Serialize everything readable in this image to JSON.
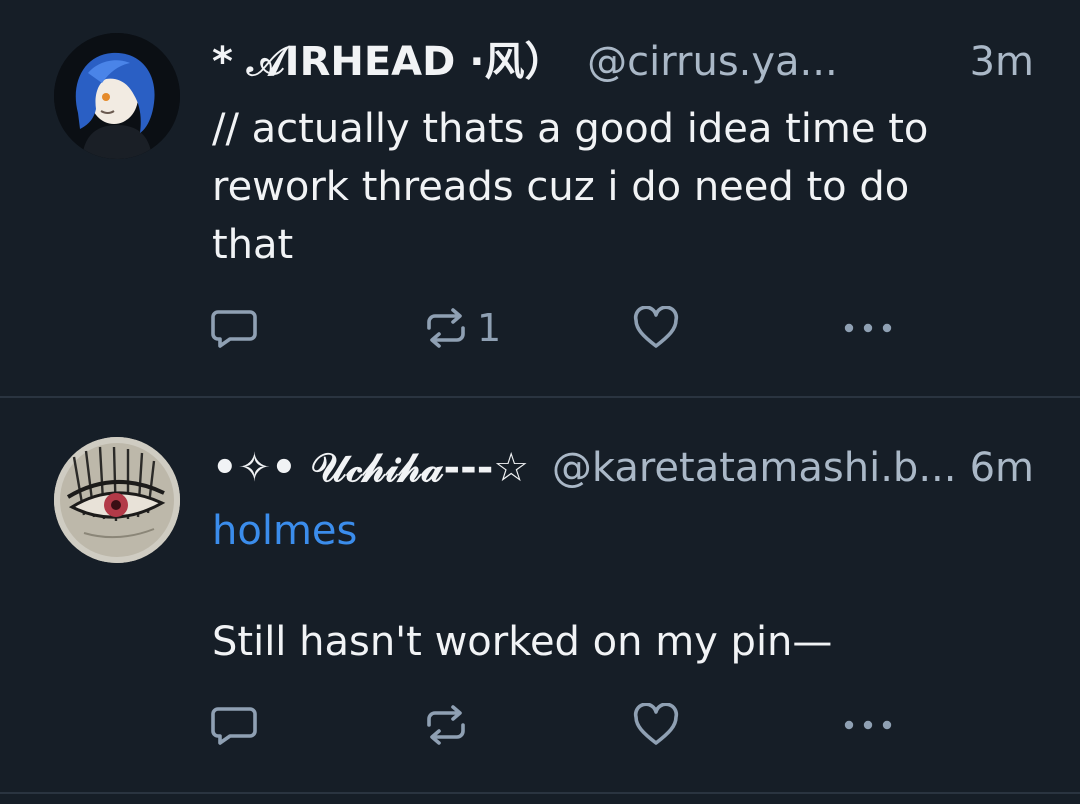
{
  "colors": {
    "background": "#161e27",
    "text_primary": "#f1f3f5",
    "text_secondary": "#aab8c7",
    "mention": "#3b8dec",
    "icon": "#8fa0b3",
    "divider": "#2a3440"
  },
  "posts": [
    {
      "display_name": "* 𝒜IRHEAD ·风）",
      "handle": "@cirrus.ya...",
      "time": "3m",
      "text": "// actually thats a good idea time to rework threads cuz i do need to do that",
      "mention": "",
      "reply_count": "",
      "repost_count": "1",
      "like_count": ""
    },
    {
      "display_name": "•✧• 𝒰𝒸𝒽𝒾𝒽𝒶---☆",
      "handle": "@karetatamashi.b...",
      "time": "6m",
      "mention": "holmes",
      "text": "Still hasn't worked on my pin—",
      "reply_count": "",
      "repost_count": "",
      "like_count": ""
    }
  ],
  "icons": {
    "reply": "speech-bubble-icon",
    "repost": "repost-arrows-icon",
    "like": "heart-icon",
    "more": "ellipsis-icon"
  }
}
